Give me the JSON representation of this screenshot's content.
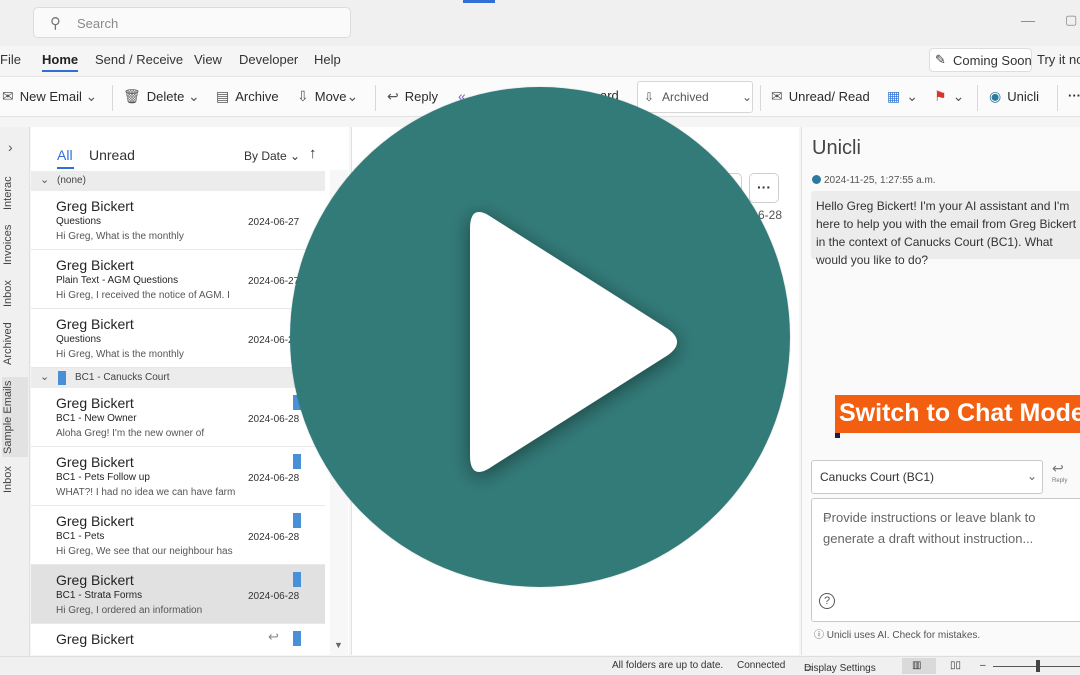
{
  "titlebar": {
    "search_placeholder": "Search",
    "minimize": "—",
    "restore": "▢"
  },
  "menu": {
    "tabs": [
      "File",
      "Home",
      "Send / Receive",
      "View",
      "Developer",
      "Help"
    ],
    "active": "Home",
    "coming_soon": "Coming Soon",
    "try_it": "Try it no"
  },
  "ribbon": {
    "new_email": "New Email",
    "delete": "Delete",
    "archive": "Archive",
    "move": "Move",
    "reply": "Reply",
    "forward_fragment": "ard",
    "archived": "Archived",
    "unread_read": "Unread/ Read",
    "unicli": "Unicli",
    "more": "···"
  },
  "rail": {
    "labels": [
      "Interac",
      "Invoices",
      "Inbox",
      "Archived",
      "Sample Emails",
      "Inbox"
    ],
    "selected_index": 4
  },
  "list": {
    "filter_all": "All",
    "filter_unread": "Unread",
    "sort": "By Date",
    "groups": [
      {
        "label": "(none)"
      },
      {
        "label": "BC1 - Canucks Court"
      }
    ],
    "messages": [
      {
        "from": "Greg Bickert",
        "subject": "Questions",
        "preview": "Hi Greg,  What is the monthly",
        "date": "2024-06-27"
      },
      {
        "from": "Greg Bickert",
        "subject": "Plain Text - AGM Questions",
        "preview": "Hi Greg,  I received the notice of AGM. I",
        "date": "2024-06-27"
      },
      {
        "from": "Greg Bickert",
        "subject": "Questions",
        "preview": "Hi Greg,  What is the monthly",
        "date": "2024-06-28"
      },
      {
        "from": "Greg Bickert",
        "subject": "BC1 - New Owner",
        "preview": "Aloha Greg!  I'm the new owner of",
        "date": "2024-06-28"
      },
      {
        "from": "Greg Bickert",
        "subject": "BC1 - Pets Follow up",
        "preview": "WHAT?! I had no idea we can have farm",
        "date": "2024-06-28"
      },
      {
        "from": "Greg Bickert",
        "subject": "BC1 - Pets",
        "preview": "Hi Greg,  We see that our neighbour has",
        "date": "2024-06-28"
      },
      {
        "from": "Greg Bickert",
        "subject": "BC1 - Strata Forms",
        "preview": "Hi Greg,  I ordered an information",
        "date": "2024-06-28"
      },
      {
        "from": "Greg Bickert",
        "subject": "",
        "preview": "",
        "date": ""
      }
    ],
    "selected_index": 6
  },
  "reading": {
    "date_fragment": "6-28"
  },
  "unicli": {
    "title": "Unicli",
    "timestamp": "2024-11-25, 1:27:55 a.m.",
    "greeting": "Hello Greg Bickert! I'm your AI assistant and I'm here to help you with the email from Greg Bickert in the context of Canucks Court (BC1). What would you like to do?",
    "banner": "Switch to Chat Mode",
    "context_select": "Canucks Court (BC1)",
    "reply_label": "Reply",
    "instructions_placeholder": "Provide instructions or leave blank to generate a draft without instruction...",
    "disclaimer": "Unicli uses AI. Check for mistakes."
  },
  "status": {
    "sync": "All folders are up to date.",
    "connection": "Connected",
    "display_settings": "Display Settings"
  },
  "colors": {
    "accent": "#2f6fd6",
    "play_overlay": "#337b79",
    "banner": "#f35f10",
    "category_tag": "#4a90d9"
  }
}
